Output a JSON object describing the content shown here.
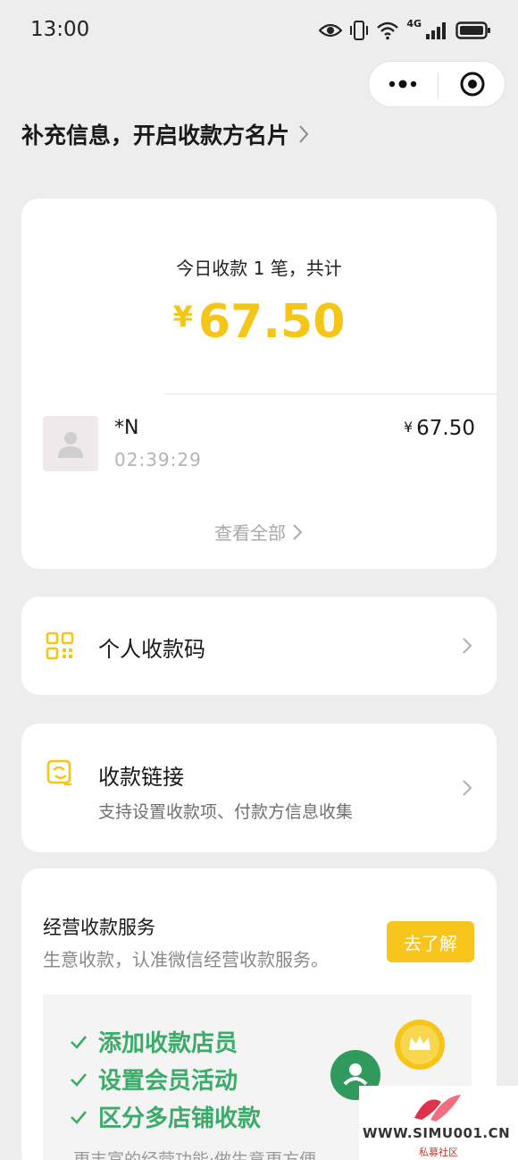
{
  "status_bar": {
    "time": "13:00",
    "network": "4G"
  },
  "capsule": {
    "more_icon": "more-dots-icon",
    "close_icon": "target-icon"
  },
  "profile_prompt": "补充信息，开启收款方名片",
  "summary": {
    "today_label": "今日收款 1 笔，共计",
    "currency": "¥",
    "total": "67.50",
    "transactions": [
      {
        "payer": "*N",
        "time": "02:39:29",
        "currency": "¥",
        "amount": "67.50"
      }
    ],
    "view_all": "查看全部"
  },
  "qr_row": {
    "title": "个人收款码",
    "icon": "qr-code-icon"
  },
  "link_row": {
    "title": "收款链接",
    "subtitle": "支持设置收款项、付款方信息收集",
    "icon": "payment-link-icon"
  },
  "business": {
    "title": "经营收款服务",
    "description": "生意收款，认准微信经营收款服务。",
    "button": "去了解",
    "features": [
      "添加收款店员",
      "设置会员活动",
      "区分多店铺收款"
    ],
    "more": "更丰富的经营功能·做生意更方便"
  },
  "watermark": {
    "text": "WWW.SIMU001.CN",
    "sub": "私募社区"
  },
  "colors": {
    "accent": "#f5c518",
    "green": "#3cab6a",
    "background": "#ededed"
  }
}
